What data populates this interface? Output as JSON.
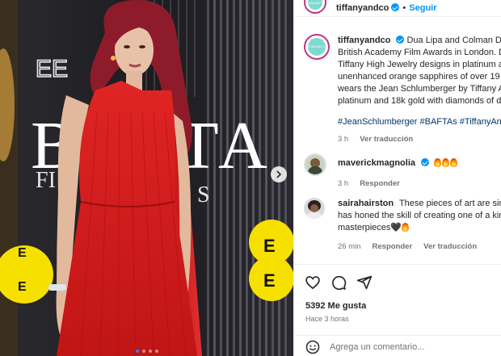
{
  "post": {
    "account": "tiffanyandco",
    "follow_label": "Seguir",
    "separator": "•",
    "caption_lines": [
      "Dua Lipa and Colman Dor",
      "British Academy Film Awards in London. D",
      "Tiffany High Jewelry designs in platinum a",
      "unenhanced orange sapphires of over 19",
      "wears the Jean Schlumberger by Tiffany A",
      "platinum and 18k gold with diamonds of d"
    ],
    "hashtags": "#JeanSchlumberger #BAFTAs #TiffanyAnd",
    "caption_time": "3 h",
    "see_translation": "Ver traducción"
  },
  "media": {
    "backdrop_word": "BAFTA",
    "backdrop_sub": "FI",
    "backdrop_sub2": "S",
    "sponsor": "EE",
    "dress_color": "#d81a1a",
    "hair_color": "#8e1b2a",
    "carousel_dots": 4,
    "active_dot": 0
  },
  "comments": [
    {
      "user": "maverickmagnolia",
      "verified": true,
      "text": "",
      "emoji": [
        "fire-emoji",
        "fire-emoji",
        "fire-emoji"
      ],
      "time": "3 h",
      "reply_label": "Responder"
    },
    {
      "user": "sairahairston",
      "verified": false,
      "lines": [
        "These pieces of art are simp",
        "has honed the skill of creating one of a kin",
        "masterpieces"
      ],
      "suffix": "🖤",
      "time": "26 min",
      "reply_label": "Responder",
      "translate_label": "Ver traducción"
    }
  ],
  "actions": {
    "likes": "5392 Me gusta",
    "time_ago": "Hace 3 horas"
  },
  "add_comment": {
    "placeholder": "Agrega un comentario..."
  },
  "colors": {
    "link_blue": "#0095f6",
    "hashtag": "#00376b",
    "muted": "#737373"
  }
}
